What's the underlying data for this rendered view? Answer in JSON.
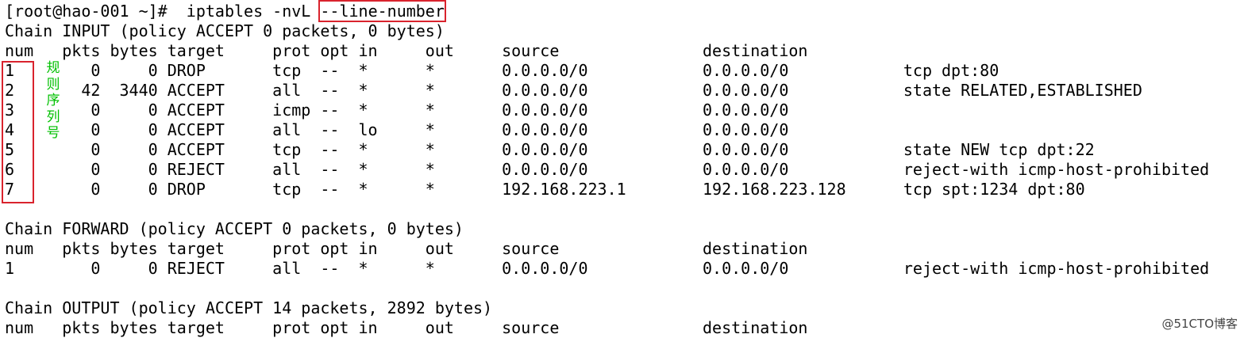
{
  "terminal": {
    "lines": [
      {
        "pre": "[root@hao-001 ~]#  iptables -nvL ",
        "highlight": "--line-number"
      },
      {
        "text": "Chain INPUT (policy ACCEPT 0 packets, 0 bytes)"
      },
      {
        "text": "num   pkts bytes target     prot opt in     out     source               destination"
      },
      {
        "text": "1        0     0 DROP       tcp  --  *      *       0.0.0.0/0            0.0.0.0/0            tcp dpt:80"
      },
      {
        "text": "2       42  3440 ACCEPT     all  --  *      *       0.0.0.0/0            0.0.0.0/0            state RELATED,ESTABLISHED"
      },
      {
        "text": "3        0     0 ACCEPT     icmp --  *      *       0.0.0.0/0            0.0.0.0/0"
      },
      {
        "text": "4        0     0 ACCEPT     all  --  lo     *       0.0.0.0/0            0.0.0.0/0"
      },
      {
        "text": "5        0     0 ACCEPT     tcp  --  *      *       0.0.0.0/0            0.0.0.0/0            state NEW tcp dpt:22"
      },
      {
        "text": "6        0     0 REJECT     all  --  *      *       0.0.0.0/0            0.0.0.0/0            reject-with icmp-host-prohibited"
      },
      {
        "text": "7        0     0 DROP       tcp  --  *      *       192.168.223.1        192.168.223.128      tcp spt:1234 dpt:80"
      },
      {
        "text": ""
      },
      {
        "text": "Chain FORWARD (policy ACCEPT 0 packets, 0 bytes)"
      },
      {
        "text": "num   pkts bytes target     prot opt in     out     source               destination"
      },
      {
        "text": "1        0     0 REJECT     all  --  *      *       0.0.0.0/0            0.0.0.0/0            reject-with icmp-host-prohibited"
      },
      {
        "text": ""
      },
      {
        "text": "Chain OUTPUT (policy ACCEPT 14 packets, 2892 bytes)"
      },
      {
        "text": "num   pkts bytes target     prot opt in     out     source               destination"
      }
    ]
  },
  "annotation": {
    "chars": [
      "规",
      "则",
      "序",
      "列",
      "号"
    ],
    "color": "#00c000"
  },
  "highlight_color": "#d9232d",
  "watermark": "@51CTO博客"
}
